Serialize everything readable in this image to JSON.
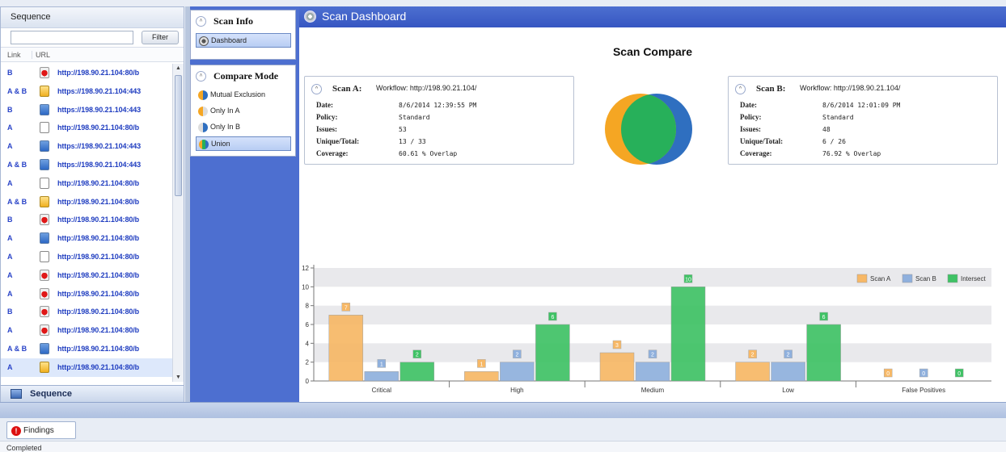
{
  "sequence": {
    "title": "Sequence",
    "filter_placeholder": "",
    "filter_button": "Filter",
    "columns": [
      "Link",
      "URL"
    ],
    "rows": [
      {
        "link": "B",
        "icon": "red",
        "url": "http://198.90.21.104:80/b"
      },
      {
        "link": "A & B",
        "icon": "yel",
        "url": "https://198.90.21.104:443"
      },
      {
        "link": "B",
        "icon": "blue",
        "url": "https://198.90.21.104:443"
      },
      {
        "link": "A",
        "icon": "doc",
        "url": "http://198.90.21.104:80/b"
      },
      {
        "link": "A",
        "icon": "blue",
        "url": "https://198.90.21.104:443"
      },
      {
        "link": "A & B",
        "icon": "blue",
        "url": "https://198.90.21.104:443"
      },
      {
        "link": "A",
        "icon": "doc",
        "url": "http://198.90.21.104:80/b"
      },
      {
        "link": "A & B",
        "icon": "yel",
        "url": "http://198.90.21.104:80/b"
      },
      {
        "link": "B",
        "icon": "red",
        "url": "http://198.90.21.104:80/b"
      },
      {
        "link": "A",
        "icon": "blue",
        "url": "http://198.90.21.104:80/b"
      },
      {
        "link": "A",
        "icon": "doc",
        "url": "http://198.90.21.104:80/b"
      },
      {
        "link": "A",
        "icon": "red",
        "url": "http://198.90.21.104:80/b"
      },
      {
        "link": "A",
        "icon": "red",
        "url": "http://198.90.21.104:80/b"
      },
      {
        "link": "B",
        "icon": "red",
        "url": "http://198.90.21.104:80/b"
      },
      {
        "link": "A",
        "icon": "red",
        "url": "http://198.90.21.104:80/b"
      },
      {
        "link": "A & B",
        "icon": "blue",
        "url": "http://198.90.21.104:80/b"
      },
      {
        "link": "A",
        "icon": "yel",
        "url": "http://198.90.21.104:80/b"
      }
    ],
    "bottom_tab": "Sequence"
  },
  "nav": {
    "scan_info_title": "Scan Info",
    "dashboard_item": "Dashboard",
    "compare_mode_title": "Compare Mode",
    "modes": [
      {
        "label": "Mutual Exclusion",
        "icon": "mutual"
      },
      {
        "label": "Only In A",
        "icon": "onlya"
      },
      {
        "label": "Only In B",
        "icon": "onlyb"
      },
      {
        "label": "Union",
        "icon": "union"
      }
    ],
    "active_mode": "Union"
  },
  "dashboard": {
    "title": "Scan Dashboard",
    "heading": "Scan Compare",
    "scan_a": {
      "name": "Scan A:",
      "workflow": "Workflow: http://198.90.21.104/",
      "date_label": "Date:",
      "date": "8/6/2014 12:39:55 PM",
      "policy_label": "Policy:",
      "policy": "Standard",
      "issues_label": "Issues:",
      "issues": "53",
      "unique_label": "Unique/Total:",
      "unique": "13 / 33",
      "coverage_label": "Coverage:",
      "coverage": "60.61 % Overlap"
    },
    "scan_b": {
      "name": "Scan B:",
      "workflow": "Workflow: http://198.90.21.104/",
      "date_label": "Date:",
      "date": "8/6/2014 12:01:09 PM",
      "policy_label": "Policy:",
      "policy": "Standard",
      "issues_label": "Issues:",
      "issues": "48",
      "unique_label": "Unique/Total:",
      "unique": "6 / 26",
      "coverage_label": "Coverage:",
      "coverage": "76.92 % Overlap"
    },
    "venn_colors": {
      "a": "#f5a623",
      "b": "#2f6fc0",
      "intersect": "#27b05a"
    }
  },
  "chart_data": {
    "type": "bar",
    "categories": [
      "Critical",
      "High",
      "Medium",
      "Low",
      "False Positives"
    ],
    "series": [
      {
        "name": "Scan A",
        "color": "#f7b866",
        "values": [
          7,
          1,
          3,
          2,
          0
        ]
      },
      {
        "name": "Scan B",
        "color": "#8fb0dd",
        "values": [
          1,
          2,
          2,
          2,
          0
        ]
      },
      {
        "name": "Intersect",
        "color": "#3fc265",
        "values": [
          2,
          6,
          10,
          6,
          0
        ]
      }
    ],
    "ylim": [
      0,
      12
    ],
    "yticks": [
      0,
      2,
      4,
      6,
      8,
      10,
      12
    ],
    "legend": "top-right",
    "grid": "alternating bands"
  },
  "bottom": {
    "findings_tab": "Findings",
    "status": "Completed"
  }
}
